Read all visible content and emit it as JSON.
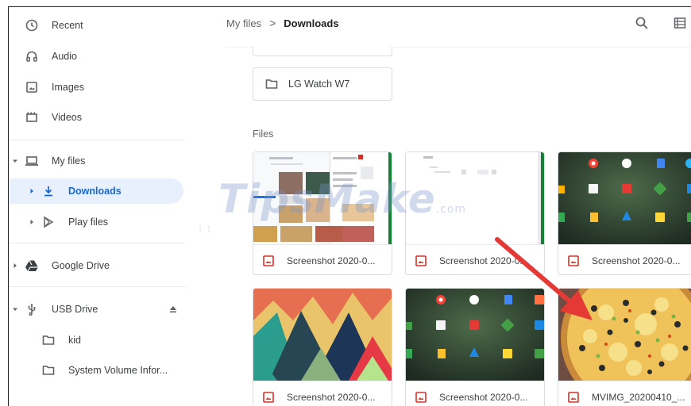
{
  "sidebar": {
    "items": [
      {
        "label": "Recent",
        "icon": "clock-icon"
      },
      {
        "label": "Audio",
        "icon": "headphones-icon"
      },
      {
        "label": "Images",
        "icon": "image-icon"
      },
      {
        "label": "Videos",
        "icon": "film-icon"
      },
      {
        "label": "My files",
        "icon": "laptop-icon"
      },
      {
        "label": "Downloads",
        "icon": "download-icon"
      },
      {
        "label": "Play files",
        "icon": "play-store-icon"
      },
      {
        "label": "Google Drive",
        "icon": "drive-icon"
      },
      {
        "label": "USB Drive",
        "icon": "usb-icon"
      },
      {
        "label": "kid",
        "icon": "folder-icon"
      },
      {
        "label": "System Volume Infor...",
        "icon": "folder-icon"
      }
    ],
    "active_color": "#1967d2"
  },
  "breadcrumb": {
    "root": "My files",
    "separator": ">",
    "current": "Downloads"
  },
  "folders": {
    "items": [
      {
        "label": ""
      },
      {
        "label": "LG Watch W7"
      }
    ]
  },
  "files": {
    "section_title": "Files",
    "items": [
      {
        "name": "Screenshot 2020-0..."
      },
      {
        "name": "Screenshot 2020-0..."
      },
      {
        "name": "Screenshot 2020-0..."
      },
      {
        "name": "Screenshot 2020-0..."
      },
      {
        "name": "Screenshot 2020-0..."
      },
      {
        "name": "MVIMG_20200410_..."
      }
    ],
    "image_icon_color": "#d93025"
  },
  "watermark": {
    "text": "TipsMake",
    "suffix": ".com"
  },
  "annotation": {
    "arrow_color": "#e53935"
  }
}
